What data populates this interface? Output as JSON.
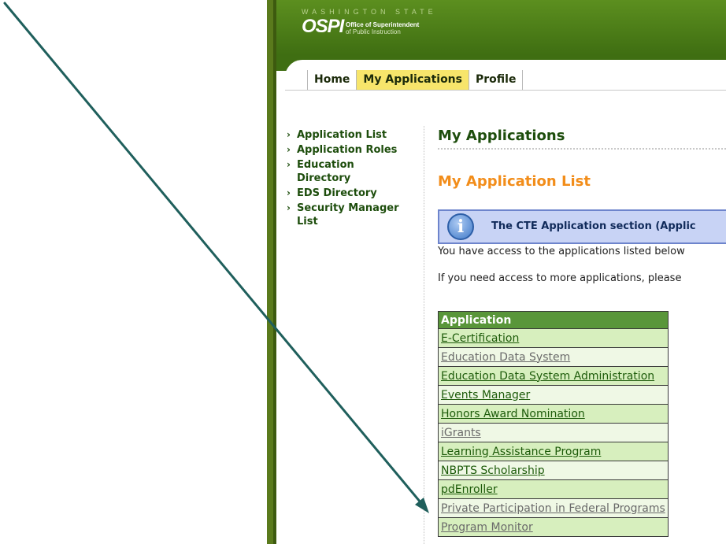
{
  "header": {
    "state_text": "WASHINGTON STATE",
    "logo": "OSPI",
    "logo_line1": "Office of Superintendent",
    "logo_line2": "of Public Instruction"
  },
  "tabs": [
    {
      "label": "Home",
      "active": false
    },
    {
      "label": "My Applications",
      "active": true
    },
    {
      "label": "Profile",
      "active": false
    }
  ],
  "sidebar": {
    "items": [
      {
        "label": "Application List"
      },
      {
        "label": "Application Roles"
      },
      {
        "label": "Education Directory"
      },
      {
        "label": "EDS Directory"
      },
      {
        "label": "Security Manager List"
      }
    ]
  },
  "main": {
    "page_title": "My Applications",
    "list_title": "My Application List",
    "info_text": "The CTE Application section (Applic",
    "access_text": "You have access to the applications listed below",
    "more_text": "If you need access to more applications, please",
    "table_header": "Application",
    "applications": [
      {
        "name": "E-Certification",
        "style": "dark"
      },
      {
        "name": "Education Data System",
        "style": "gray"
      },
      {
        "name": "Education Data System Administration",
        "style": "dark"
      },
      {
        "name": "Events Manager",
        "style": "dark"
      },
      {
        "name": "Honors Award Nomination",
        "style": "dark"
      },
      {
        "name": "iGrants",
        "style": "gray"
      },
      {
        "name": "Learning Assistance Program",
        "style": "dark"
      },
      {
        "name": "NBPTS Scholarship",
        "style": "dark"
      },
      {
        "name": "pdEnroller",
        "style": "dark"
      },
      {
        "name": "Private Participation in Federal Programs",
        "style": "gray"
      },
      {
        "name": "Program Monitor",
        "style": "gray"
      }
    ]
  },
  "colors": {
    "header_green": "#3f6e12",
    "active_tab": "#f7e56b",
    "nav_text": "#1d4d0c",
    "list_title": "#f28d1a",
    "annotation_arrow": "#1f5f5c"
  }
}
